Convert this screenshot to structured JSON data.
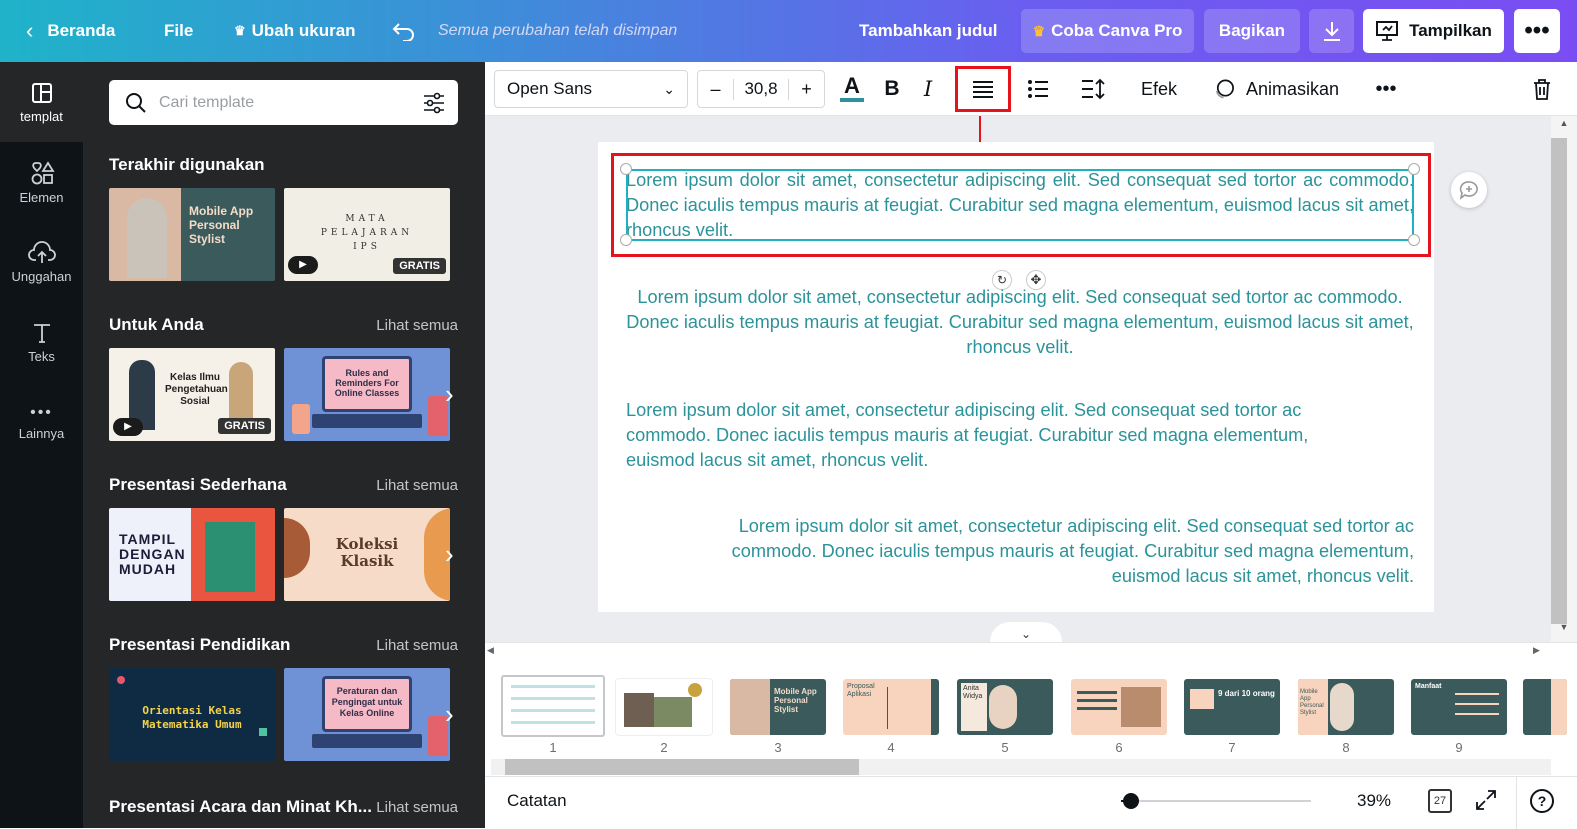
{
  "topbar": {
    "home": "Beranda",
    "file": "File",
    "resize": "Ubah ukuran",
    "save_status": "Semua perubahan telah disimpan",
    "add_title": "Tambahkan judul",
    "try_pro": "Coba Canva Pro",
    "share": "Bagikan",
    "present": "Tampilkan"
  },
  "rail": {
    "items": [
      {
        "label": "templat",
        "icon": "template-icon"
      },
      {
        "label": "Elemen",
        "icon": "elements-icon"
      },
      {
        "label": "Unggahan",
        "icon": "upload-icon"
      },
      {
        "label": "Teks",
        "icon": "text-icon"
      },
      {
        "label": "Lainnya",
        "icon": "more-icon"
      }
    ]
  },
  "panel": {
    "search_placeholder": "Cari template",
    "see_all": "Lihat semua",
    "sections": [
      {
        "title": "Terakhir digunakan"
      },
      {
        "title": "Untuk Anda"
      },
      {
        "title": "Presentasi Sederhana"
      },
      {
        "title": "Presentasi Pendidikan"
      },
      {
        "title": "Presentasi Acara dan Minat Kh..."
      }
    ],
    "thumbs": {
      "t1": "Mobile App Personal Stylist",
      "t2": "MATA PELAJARAN IPS",
      "t3": "Kelas Ilmu Pengetahuan Sosial",
      "t4": "Rules and Reminders For Online Classes",
      "t5": "TAMPIL DENGAN MUDAH",
      "t6": "Koleksi Klasik",
      "t7": "Orientasi Kelas Matematika Umum",
      "t8": "Peraturan dan Pengingat untuk Kelas Online"
    },
    "badge_free": "GRATIS"
  },
  "toolbar": {
    "font": "Open Sans",
    "font_size": "30,8",
    "minus": "–",
    "plus": "+",
    "effects": "Efek",
    "animate": "Animasikan",
    "accent_color": "#2b9399",
    "highlight_color": "#e5131b"
  },
  "canvas": {
    "paragraph": "Lorem ipsum dolor sit amet, consectetur adipiscing elit. Sed consequat sed tortor ac commodo. Donec iaculis tempus mauris at feugiat. Curabitur sed magna elementum, euismod lacus sit amet, rhoncus velit.",
    "alignments": [
      "justify",
      "center",
      "left",
      "right"
    ]
  },
  "filmstrip": {
    "slides": [
      "1",
      "2",
      "3",
      "4",
      "5",
      "6",
      "7",
      "8",
      "9"
    ],
    "s3_title": "Mobile App Personal Stylist",
    "s4_title": "Proposal Aplikasi",
    "s5_title": "Anita Widya",
    "s7_title": "9 dari 10 orang",
    "s8_title": "Mobile App Personal Stylist",
    "s9_title": "Manfaat"
  },
  "footer": {
    "notes": "Catatan",
    "zoom": "39%",
    "zoom_fraction": 0.05,
    "page_count": "27"
  }
}
